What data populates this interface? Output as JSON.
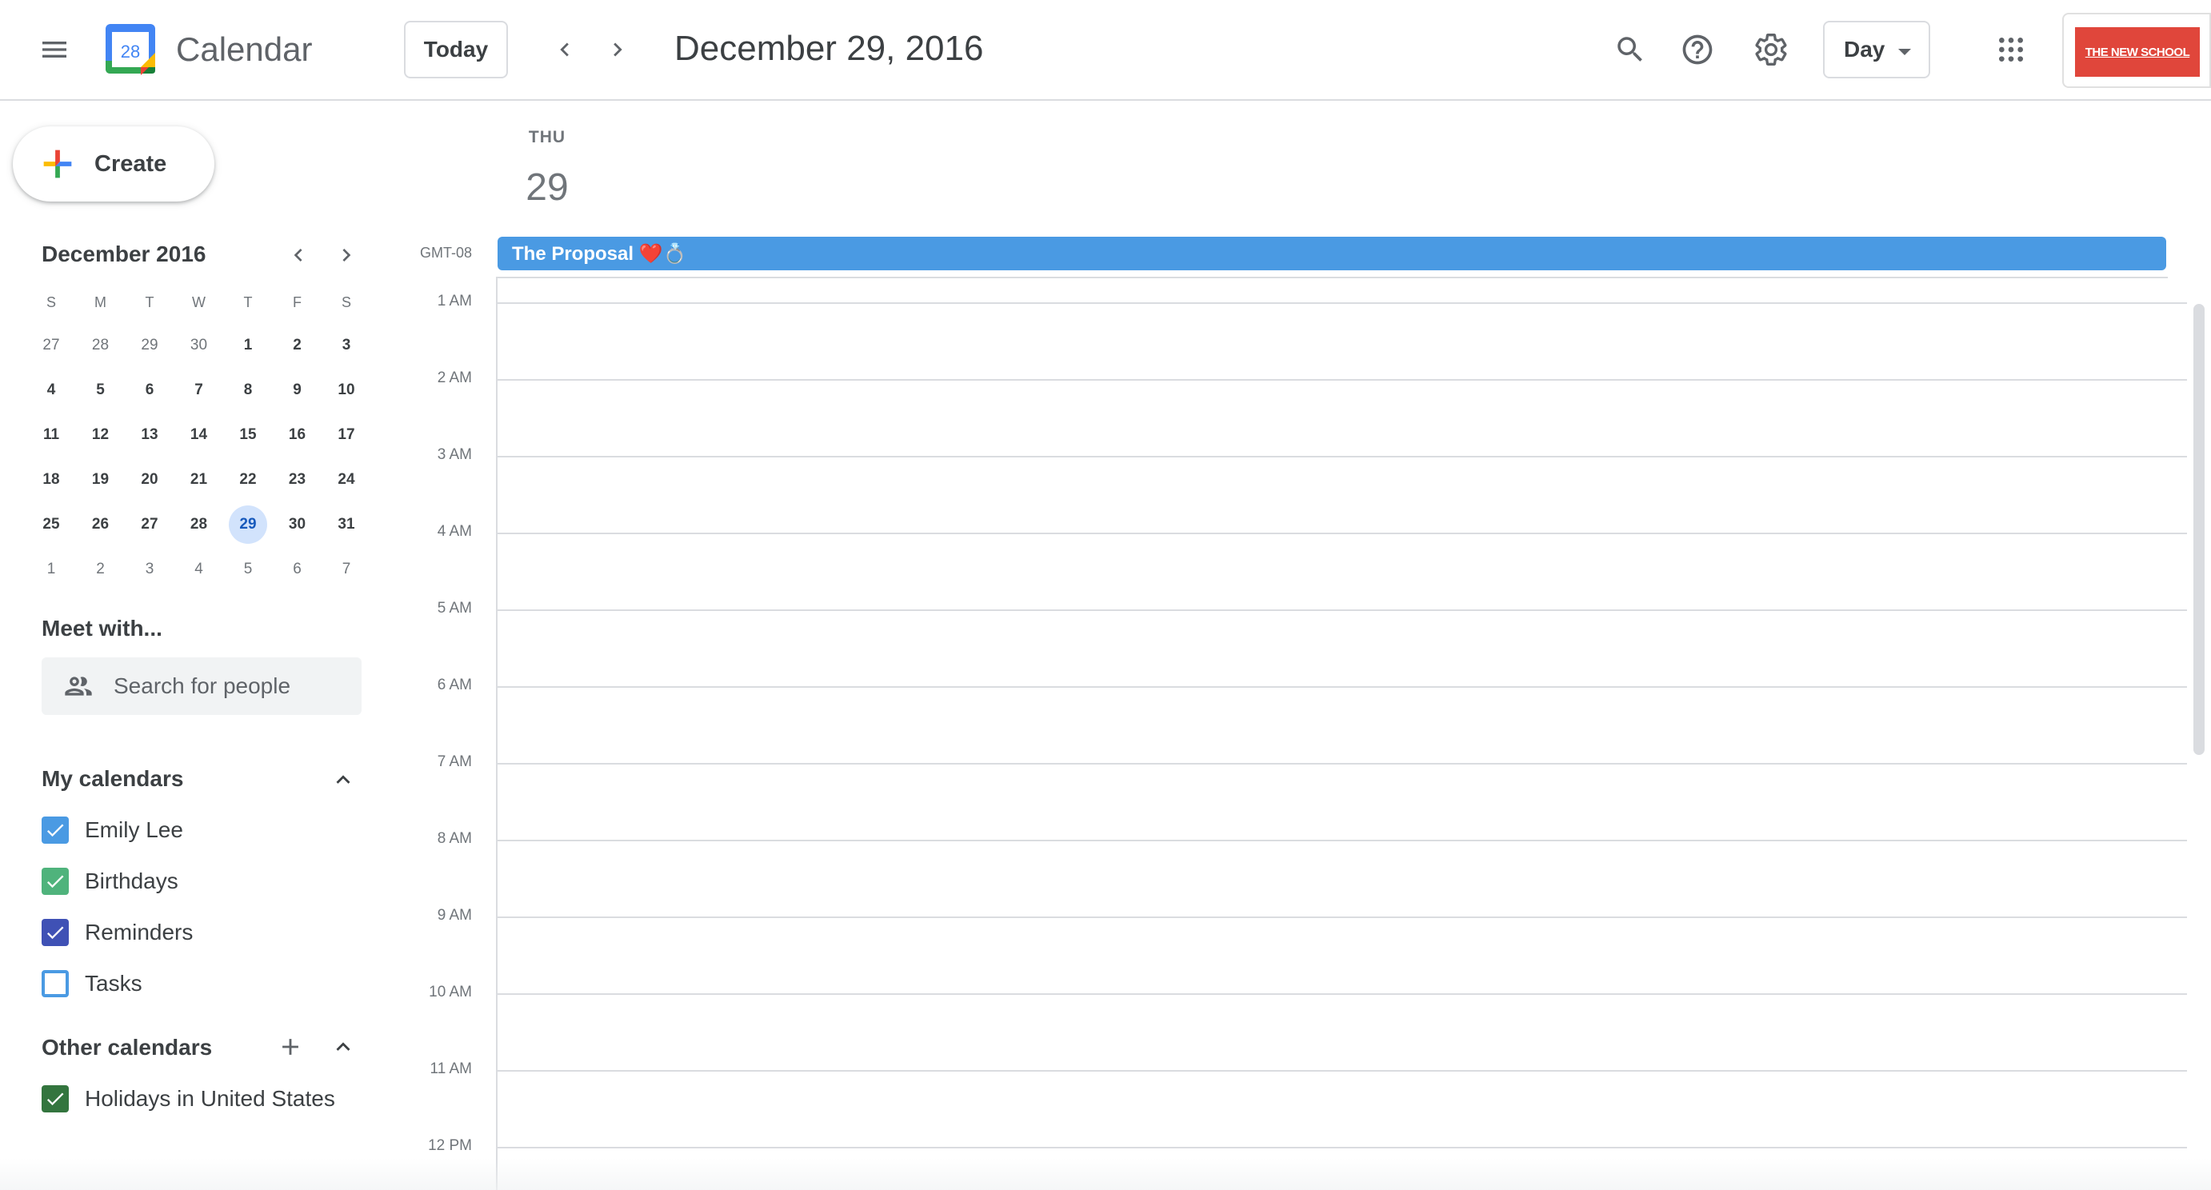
{
  "header": {
    "app_title": "Calendar",
    "logo_day": "28",
    "today_label": "Today",
    "date_title": "December 29, 2016",
    "view_label": "Day",
    "account_logo_text": "THE NEW SCHOOL"
  },
  "sidebar": {
    "create_label": "Create",
    "mini_calendar": {
      "month_label": "December 2016",
      "weekday_headers": [
        "S",
        "M",
        "T",
        "W",
        "T",
        "F",
        "S"
      ],
      "weeks": [
        [
          "27",
          "28",
          "29",
          "30",
          "1",
          "2",
          "3"
        ],
        [
          "4",
          "5",
          "6",
          "7",
          "8",
          "9",
          "10"
        ],
        [
          "11",
          "12",
          "13",
          "14",
          "15",
          "16",
          "17"
        ],
        [
          "18",
          "19",
          "20",
          "21",
          "22",
          "23",
          "24"
        ],
        [
          "25",
          "26",
          "27",
          "28",
          "29",
          "30",
          "31"
        ],
        [
          "1",
          "2",
          "3",
          "4",
          "5",
          "6",
          "7"
        ]
      ],
      "selected_day": "29"
    },
    "meet_with_title": "Meet with...",
    "search_people_placeholder": "Search for people",
    "my_calendars_title": "My calendars",
    "my_calendars": [
      {
        "label": "Emily Lee",
        "color": "#4a9ae3",
        "checked": true
      },
      {
        "label": "Birthdays",
        "color": "#4fb37c",
        "checked": true
      },
      {
        "label": "Reminders",
        "color": "#3f51b5",
        "checked": true
      },
      {
        "label": "Tasks",
        "color": "#4a9ae3",
        "checked": false
      }
    ],
    "other_calendars_title": "Other calendars",
    "other_calendars": [
      {
        "label": "Holidays in United States",
        "color": "#33753e",
        "checked": true
      }
    ]
  },
  "day_view": {
    "day_name": "THU",
    "day_number": "29",
    "timezone": "GMT-08",
    "all_day_event": "The Proposal ❤️💍",
    "event_color": "#4a9ae3",
    "hours": [
      "1 AM",
      "2 AM",
      "3 AM",
      "4 AM",
      "5 AM",
      "6 AM",
      "7 AM",
      "8 AM",
      "9 AM",
      "10 AM",
      "11 AM",
      "12 PM"
    ]
  },
  "colors": {
    "accent": "#1a73e8",
    "selected_day_bg": "#d2e3fc",
    "account_logo_bg": "#e0463b"
  }
}
